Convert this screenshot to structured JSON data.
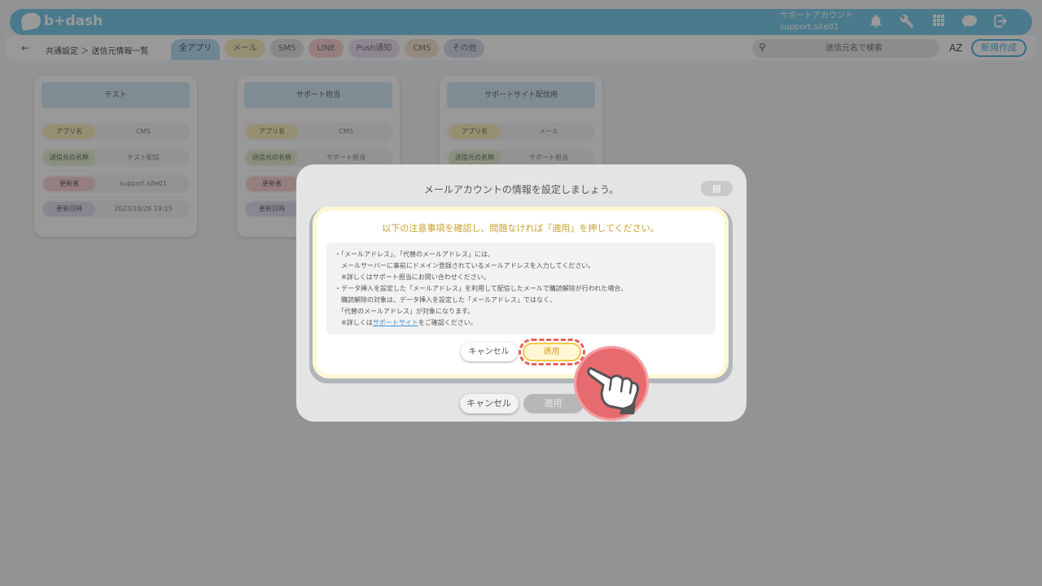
{
  "app": {
    "logo_text": "b+dash",
    "account_label": "サポートアカウント",
    "account_id": "support.site01"
  },
  "icons": {
    "bell": "bell-icon",
    "wrench": "wrench-icon",
    "apps": "apps-grid-icon",
    "chat": "chat-icon",
    "logout": "logout-icon",
    "search": "search-icon",
    "back": "back-arrow-icon",
    "sort": "sort-az-icon",
    "pointer": "hand-pointer-icon",
    "doc": "document-icon"
  },
  "header": {
    "back_glyph": "←",
    "breadcrumb": "共通設定 ＞ 送信元情報一覧",
    "tabs": [
      {
        "label": "全アプリ",
        "color": "#b9e0f4"
      },
      {
        "label": "メール",
        "color": "#f8f1c2"
      },
      {
        "label": "SMS",
        "color": "#e3e3e3"
      },
      {
        "label": "LINE",
        "color": "#f9d2d0"
      },
      {
        "label": "Push通知",
        "color": "#ebe2f2"
      },
      {
        "label": "CMS",
        "color": "#f6e5d0"
      },
      {
        "label": "その他",
        "color": "#d8dee8"
      }
    ],
    "search_placeholder": "送信元名で検索",
    "sort_label": "AZ",
    "new_button": "新規作成"
  },
  "cards": [
    {
      "title": "テスト",
      "rows": [
        {
          "label": "アプリ名",
          "value": "CMS",
          "color": "#fbeebc"
        },
        {
          "label": "送信元の名称",
          "value": "テスト配信",
          "color": "#e3f0d0"
        },
        {
          "label": "更新者",
          "value": "support.site01",
          "color": "#f9d3d3"
        },
        {
          "label": "更新日時",
          "value": "2023/10/26 19:15",
          "color": "#e5e0f2"
        }
      ]
    },
    {
      "title": "サポート担当",
      "rows": [
        {
          "label": "アプリ名",
          "value": "CMS",
          "color": "#fbeebc"
        },
        {
          "label": "送信元の名称",
          "value": "サポート担当",
          "color": "#e3f0d0"
        },
        {
          "label": "更新者",
          "value": "",
          "color": "#f9d3d3"
        },
        {
          "label": "更新日時",
          "value": "",
          "color": "#e5e0f2"
        }
      ]
    },
    {
      "title": "サポートサイト配信用",
      "rows": [
        {
          "label": "アプリ名",
          "value": "メール",
          "color": "#fbeebc"
        },
        {
          "label": "送信元の名称",
          "value": "サポート担当",
          "color": "#e3f0d0"
        }
      ]
    }
  ],
  "modal": {
    "title": "メールアカウントの情報を設定しましょう。",
    "cancel": "キャンセル",
    "apply": "適用"
  },
  "confirm": {
    "title": "以下の注意事項を確認し、問題なければ「適用」を押してください。",
    "lines": [
      "・「メールアドレス」、「代替のメールアドレス」には、",
      "　メールサーバーに事前にドメイン登録されているメールアドレスを入力してください。",
      "　※詳しくはサポート担当にお問い合わせください。",
      "・データ挿入を設定した「メールアドレス」を利用して配信したメールで購読解除が行われた場合、",
      "　購読解除の対象は、データ挿入を設定した「メールアドレス」ではなく、",
      "　「代替のメールアドレス」が対象になります。"
    ],
    "last_prefix": "　※詳しくは",
    "link": "サポートサイト",
    "last_suffix": "をご確認ください。",
    "cancel": "キャンセル",
    "apply": "適用"
  }
}
